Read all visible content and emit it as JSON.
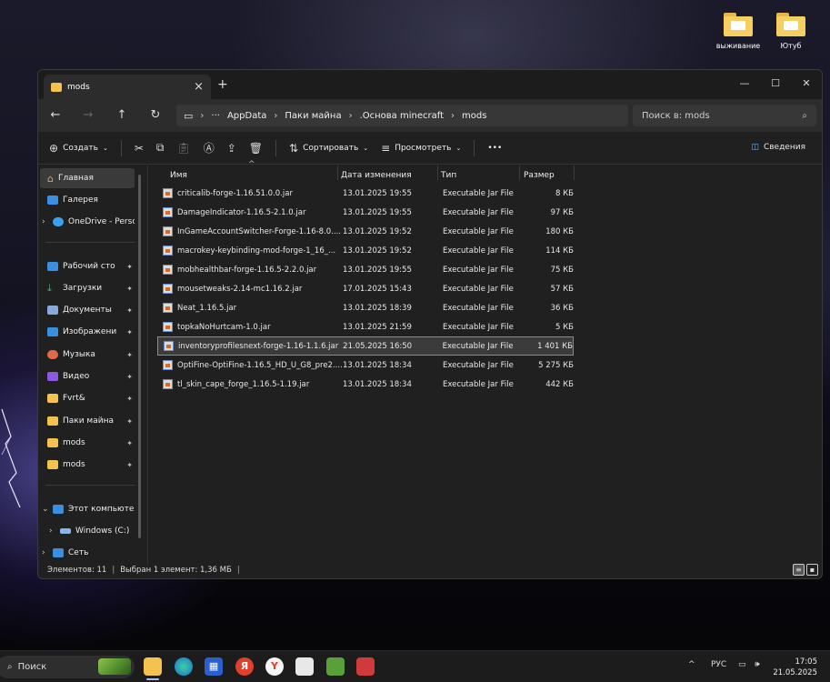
{
  "desktop": {
    "icons": [
      {
        "label": "выживание",
        "icon": "folder-icon"
      },
      {
        "label": "Ютуб",
        "icon": "folder-icon"
      }
    ]
  },
  "window": {
    "tab_title": "mods",
    "new_tab": "+",
    "controls": {
      "minimize": "—",
      "maximize": "☐",
      "close": "✕"
    }
  },
  "nav": {
    "back": "←",
    "forward": "→",
    "up": "↑",
    "refresh": "↻",
    "breadcrumb": [
      "AppData",
      "Паки майна",
      ".Основа minecraft",
      "mods"
    ],
    "ellipsis": "···",
    "search_placeholder": "Поиск в: mods"
  },
  "toolbar": {
    "create_label": "Создать",
    "sort_label": "Сортировать",
    "view_label": "Просмотреть",
    "more_label": "•••",
    "details_label": "Сведения"
  },
  "sidebar": {
    "items": [
      {
        "label": "Главная",
        "icon": "home-icon",
        "color": "#f0a23a"
      },
      {
        "label": "Галерея",
        "icon": "gallery-icon",
        "color": "#3b8fe0"
      },
      {
        "label": "OneDrive - Perso",
        "icon": "cloud-icon",
        "color": "#3aa0f0"
      },
      {
        "label": "Рабочий сто",
        "icon": "desktop-icon",
        "color": "#3b8fe0"
      },
      {
        "label": "Загрузки",
        "icon": "download-icon",
        "color": "#4cb87a"
      },
      {
        "label": "Документы",
        "icon": "document-icon",
        "color": "#8aa8d8"
      },
      {
        "label": "Изображени",
        "icon": "pictures-icon",
        "color": "#3b8fe0"
      },
      {
        "label": "Музыка",
        "icon": "music-icon",
        "color": "#e06a4a"
      },
      {
        "label": "Видео",
        "icon": "video-icon",
        "color": "#8a5ae0"
      },
      {
        "label": "Fvrt&",
        "icon": "folder-icon",
        "color": "#f3c24f"
      },
      {
        "label": "Паки майна",
        "icon": "folder-icon",
        "color": "#f3c24f"
      },
      {
        "label": "mods",
        "icon": "folder-icon",
        "color": "#f3c24f"
      },
      {
        "label": "mods",
        "icon": "folder-icon",
        "color": "#f3c24f"
      },
      {
        "label": "Этот компьюте",
        "icon": "computer-icon",
        "color": "#3b8fe0"
      },
      {
        "label": "Windows (C:)",
        "icon": "drive-icon",
        "color": "#8ab4e8"
      },
      {
        "label": "Сеть",
        "icon": "network-icon",
        "color": "#3b8fe0"
      }
    ]
  },
  "columns": {
    "name": "Имя",
    "date": "Дата изменения",
    "type": "Тип",
    "size": "Размер"
  },
  "files": [
    {
      "name": "criticalib-forge-1.16.51.0.0.jar",
      "date": "13.01.2025 19:55",
      "type": "Executable Jar File",
      "size": "8 КБ"
    },
    {
      "name": "DamageIndicator-1.16.5-2.1.0.jar",
      "date": "13.01.2025 19:55",
      "type": "Executable Jar File",
      "size": "97 КБ"
    },
    {
      "name": "InGameAccountSwitcher-Forge-1.16-8.0....",
      "date": "13.01.2025 19:52",
      "type": "Executable Jar File",
      "size": "180 КБ"
    },
    {
      "name": "macrokey-keybinding-mod-forge-1_16_...",
      "date": "13.01.2025 19:52",
      "type": "Executable Jar File",
      "size": "114 КБ"
    },
    {
      "name": "mobhealthbar-forge-1.16.5-2.2.0.jar",
      "date": "13.01.2025 19:55",
      "type": "Executable Jar File",
      "size": "75 КБ"
    },
    {
      "name": "mousetweaks-2.14-mc1.16.2.jar",
      "date": "17.01.2025 15:43",
      "type": "Executable Jar File",
      "size": "57 КБ"
    },
    {
      "name": "Neat_1.16.5.jar",
      "date": "13.01.2025 18:39",
      "type": "Executable Jar File",
      "size": "36 КБ"
    },
    {
      "name": "topkaNoHurtcam-1.0.jar",
      "date": "13.01.2025 21:59",
      "type": "Executable Jar File",
      "size": "5 КБ"
    },
    {
      "name": "inventoryprofilesnext-forge-1.16-1.1.6.jar",
      "date": "21.05.2025 16:50",
      "type": "Executable Jar File",
      "size": "1 401 КБ",
      "selected": true
    },
    {
      "name": "OptiFine-OptiFine-1.16.5_HD_U_G8_pre2....",
      "date": "13.01.2025 18:34",
      "type": "Executable Jar File",
      "size": "5 275 КБ"
    },
    {
      "name": "tl_skin_cape_forge_1.16.5-1.19.jar",
      "date": "13.01.2025 18:34",
      "type": "Executable Jar File",
      "size": "442 КБ"
    }
  ],
  "status": {
    "count": "Элементов: 11",
    "selected": "Выбран 1 элемент: 1,36 МБ"
  },
  "taskbar": {
    "search_label": "Поиск",
    "tray_lang": "РУС",
    "tray_chevron": "^",
    "time": "17:05",
    "date": "21.05.2025"
  }
}
